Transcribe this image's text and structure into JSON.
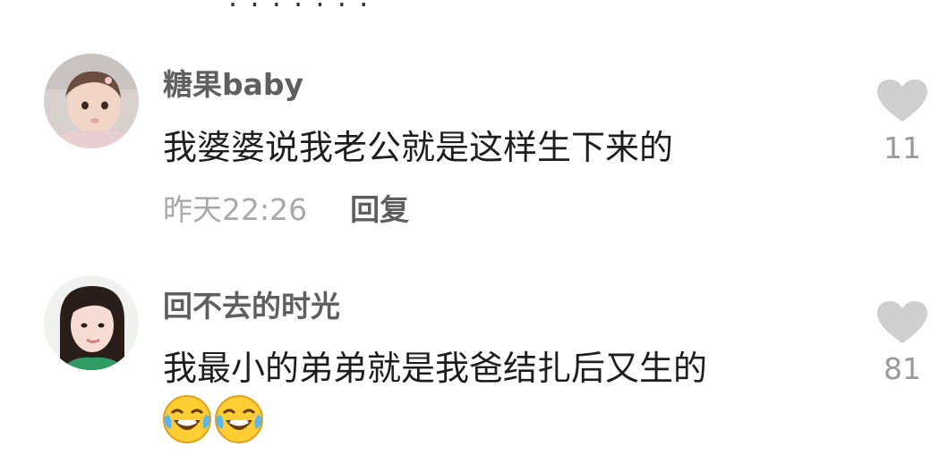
{
  "cutoff_text": "· · · · · · ·",
  "comments": [
    {
      "username": "糖果baby",
      "text": "我婆婆说我老公就是这样生下来的",
      "time": "昨天22:26",
      "reply_label": "回复",
      "likes": "11",
      "avatar_icon": "baby-girl-avatar",
      "like_icon": "heart-icon"
    },
    {
      "username": "回不去的时光",
      "text": "我最小的弟弟就是我爸结扎后又生的",
      "likes": "81",
      "emojis": [
        "laughing-crying-emoji",
        "laughing-crying-emoji"
      ],
      "avatar_icon": "woman-avatar",
      "like_icon": "heart-icon"
    }
  ],
  "colors": {
    "username": "#5f5f5f",
    "content": "#1e1e1e",
    "meta": "#a9a9a9",
    "heart": "#cfcfcf"
  }
}
